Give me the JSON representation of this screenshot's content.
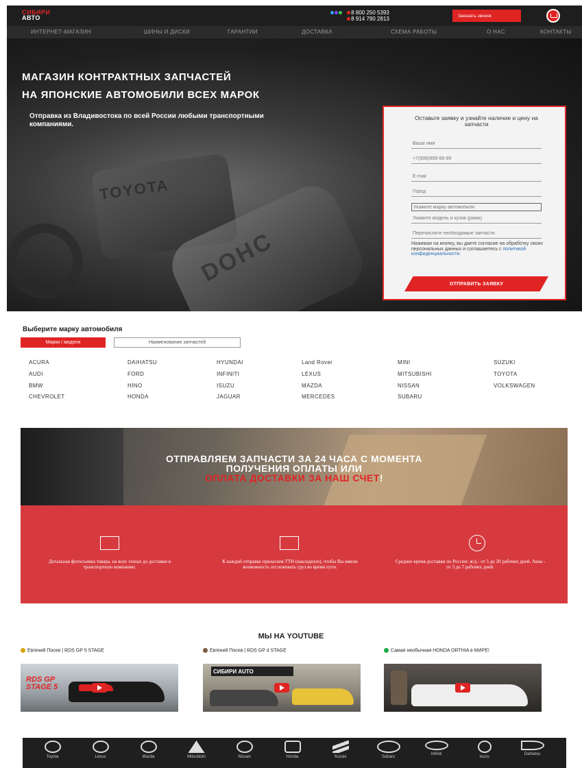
{
  "header": {
    "logo_line1": "СИБИРИ",
    "logo_line2": "АВТО",
    "phone1": "8 800 250 5393",
    "phone2": "8 914 790 2813",
    "call_button": "Заказать звонок",
    "dot_colors": [
      "#2ea8ff",
      "#7a4dff",
      "#3ccf5a",
      "#e02424"
    ]
  },
  "nav": {
    "items": [
      "ИНТЕРНЕТ-МАГАЗИН",
      "ШИНЫ И ДИСКИ",
      "ГАРАНТИИ",
      "ДОСТАВКА",
      "СХЕМА РАБОТЫ",
      "О НАС",
      "КОНТАКТЫ"
    ]
  },
  "hero": {
    "title_line1": "МАГАЗИН КОНТРАКТНЫХ ЗАПЧАСТЕЙ",
    "title_line2": "НА ЯПОНСКИЕ АВТОМОБИЛИ ВСЕХ МАРОК",
    "subtitle": "Отправка из Владивостока по всей России любыми транспортными компаниями.",
    "engraving1": "TOYOTA",
    "engraving2": "DOHC"
  },
  "form": {
    "title": "Оставьте заявку и узнайте наличие и цену на запчасти",
    "name_placeholder": "Ваше имя",
    "phone_placeholder": "+7(999)999-99-99",
    "email_placeholder": "E-mail",
    "city_placeholder": "Город",
    "brand_placeholder": "Укажите марку автомобиля",
    "model_placeholder": "Укажите модель и кузов (рама)",
    "parts_placeholder": "Перечислите необходимые запчасти",
    "consent_text": "Нажимая на кнопку, вы даете согласие на обработку своих персональных данных и соглашаетесь с ",
    "consent_link": "политикой конфиденциальности.",
    "submit": "ОТПРАВИТЬ ЗАЯВКУ"
  },
  "brands": {
    "title": "Выберите марку автомобиля",
    "tab_active": "Марки / модели",
    "tab_inactive": "Наименования запчастей",
    "columns": [
      [
        "ACURA",
        "AUDI",
        "BMW",
        "CHEVROLET"
      ],
      [
        "DAIHATSU",
        "FORD",
        "HINO",
        "HONDA"
      ],
      [
        "HYUNDAI",
        "INFINITI",
        "ISUZU",
        "JAGUAR"
      ],
      [
        "Land Rover",
        "LEXUS",
        "MAZDA",
        "MERCEDES"
      ],
      [
        "MINI",
        "MITSUBISHI",
        "NISSAN",
        "SUBARU"
      ],
      [
        "SUZUKI",
        "TOYOTA",
        "VOLKSWAGEN"
      ]
    ]
  },
  "promo": {
    "line1": "ОТПРАВЛЯЕМ ЗАПЧАСТИ ЗА 24 ЧАСА С МОМЕНТА",
    "line2": "ПОЛУЧЕНИЯ ОПЛАТЫ ИЛИ",
    "line3": "ОПЛАТА ДОСТАВКИ ЗА НАШ СЧЕТ",
    "line3_end": "!",
    "features": [
      "Детальная фотосъемка товара, на всех этапах до доставки в транспортную компанию.",
      "К каждой отправке прилагаем ТТН (накладную), чтобы Вы имели возможность отслеживать груз во время пути.",
      "Среднее время доставки по России: ж/д - от 5 до 20 рабочих дней. Авиа - от 3 до 7 рабочих дней."
    ]
  },
  "youtube": {
    "title": "МЫ НА YOUTUBE",
    "videos": [
      {
        "title": "Евгений Посев | RDS GP 5 STAGE",
        "bullet": "#d9a400",
        "thumb_label": "RDS GP STAGE 5"
      },
      {
        "title": "Евгений Посев | RDS GP 4 STAGE",
        "bullet": "#7a5a3a",
        "thumb_label": "СИБИРИ AUTO"
      },
      {
        "title": "Самая необычная HONDA ORTHIA в МИРЕ!",
        "bullet": "#1ea84a",
        "thumb_label": ""
      }
    ]
  },
  "logos": [
    "Toyota",
    "Lexus",
    "Mazda",
    "Mitsubishi",
    "Nissan",
    "Honda",
    "Suzuki",
    "Subaru",
    "Infiniti",
    "Isuzu",
    "Daihatsu"
  ]
}
